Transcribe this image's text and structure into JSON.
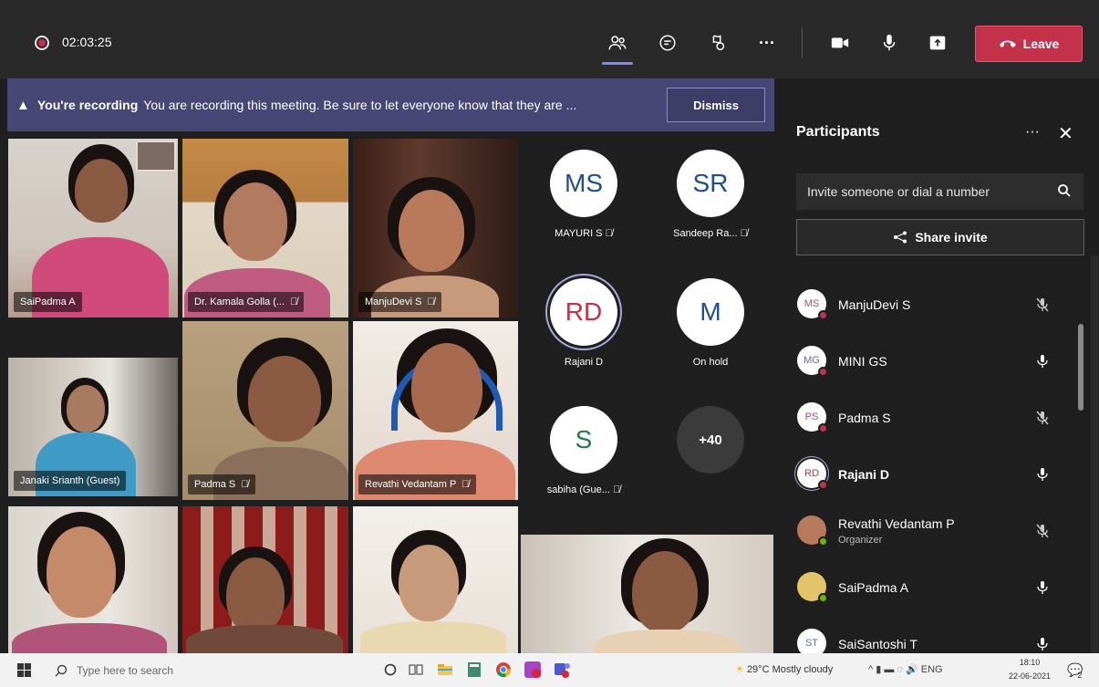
{
  "meeting": {
    "timer": "02:03:25",
    "leave_label": "Leave"
  },
  "banner": {
    "title": "You're recording",
    "message": "You are recording this meeting. Be sure to let everyone know that they are ...",
    "dismiss_label": "Dismiss"
  },
  "video_tiles": [
    {
      "name": "SaiPadma A",
      "muted": false
    },
    {
      "name": "Dr. Kamala Golla (...",
      "muted": true
    },
    {
      "name": "ManjuDevi S",
      "muted": true
    },
    {
      "name": "Janaki Srianth (Guest)",
      "muted": false
    },
    {
      "name": "Padma S",
      "muted": true
    },
    {
      "name": "Revathi Vedantam P",
      "muted": true
    },
    {
      "name": "",
      "muted": false
    },
    {
      "name": "",
      "muted": false
    },
    {
      "name": "",
      "muted": false
    },
    {
      "name": "",
      "muted": false
    }
  ],
  "avatar_tiles": [
    {
      "initials": "MS",
      "name": "MAYURI S",
      "muted": true,
      "color": "#1f4e8c"
    },
    {
      "initials": "SR",
      "name": "Sandeep Ra...",
      "muted": true,
      "color": "#1f4e8c"
    },
    {
      "initials": "RD",
      "name": "Rajani D",
      "muted": false,
      "color": "#c4314b"
    },
    {
      "initials": "M",
      "name": "On hold",
      "muted": false,
      "color": "#1f4e8c"
    },
    {
      "initials": "S",
      "name": "sabiha (Gue...",
      "muted": true,
      "color": "#237b4b"
    }
  ],
  "overflow_count": "+40",
  "panel": {
    "title": "Participants",
    "more": "···",
    "invite_placeholder": "Invite someone or dial a number",
    "share_label": "Share invite",
    "participants": [
      {
        "initials": "MS",
        "name": "ManjuDevi S",
        "role": "",
        "muted": true
      },
      {
        "initials": "MG",
        "name": "MINI GS",
        "role": "",
        "muted": false
      },
      {
        "initials": "PS",
        "name": "Padma S",
        "role": "",
        "muted": true
      },
      {
        "initials": "RD",
        "name": "Rajani D",
        "role": "",
        "muted": false
      },
      {
        "initials": "",
        "name": "Revathi Vedantam P",
        "role": "Organizer",
        "muted": true
      },
      {
        "initials": "",
        "name": "SaiPadma A",
        "role": "",
        "muted": false
      },
      {
        "initials": "ST",
        "name": "SaiSantoshi T",
        "role": "",
        "muted": false
      }
    ]
  },
  "taskbar": {
    "search_placeholder": "Type here to search",
    "weather": "29°C  Mostly cloudy",
    "language": "ENG",
    "time": "18:10",
    "date": "22-06-2021",
    "notification_count": "2"
  },
  "colors": {
    "leave": "#c4314b",
    "banner": "#464775",
    "accent": "#8b8cc7"
  }
}
